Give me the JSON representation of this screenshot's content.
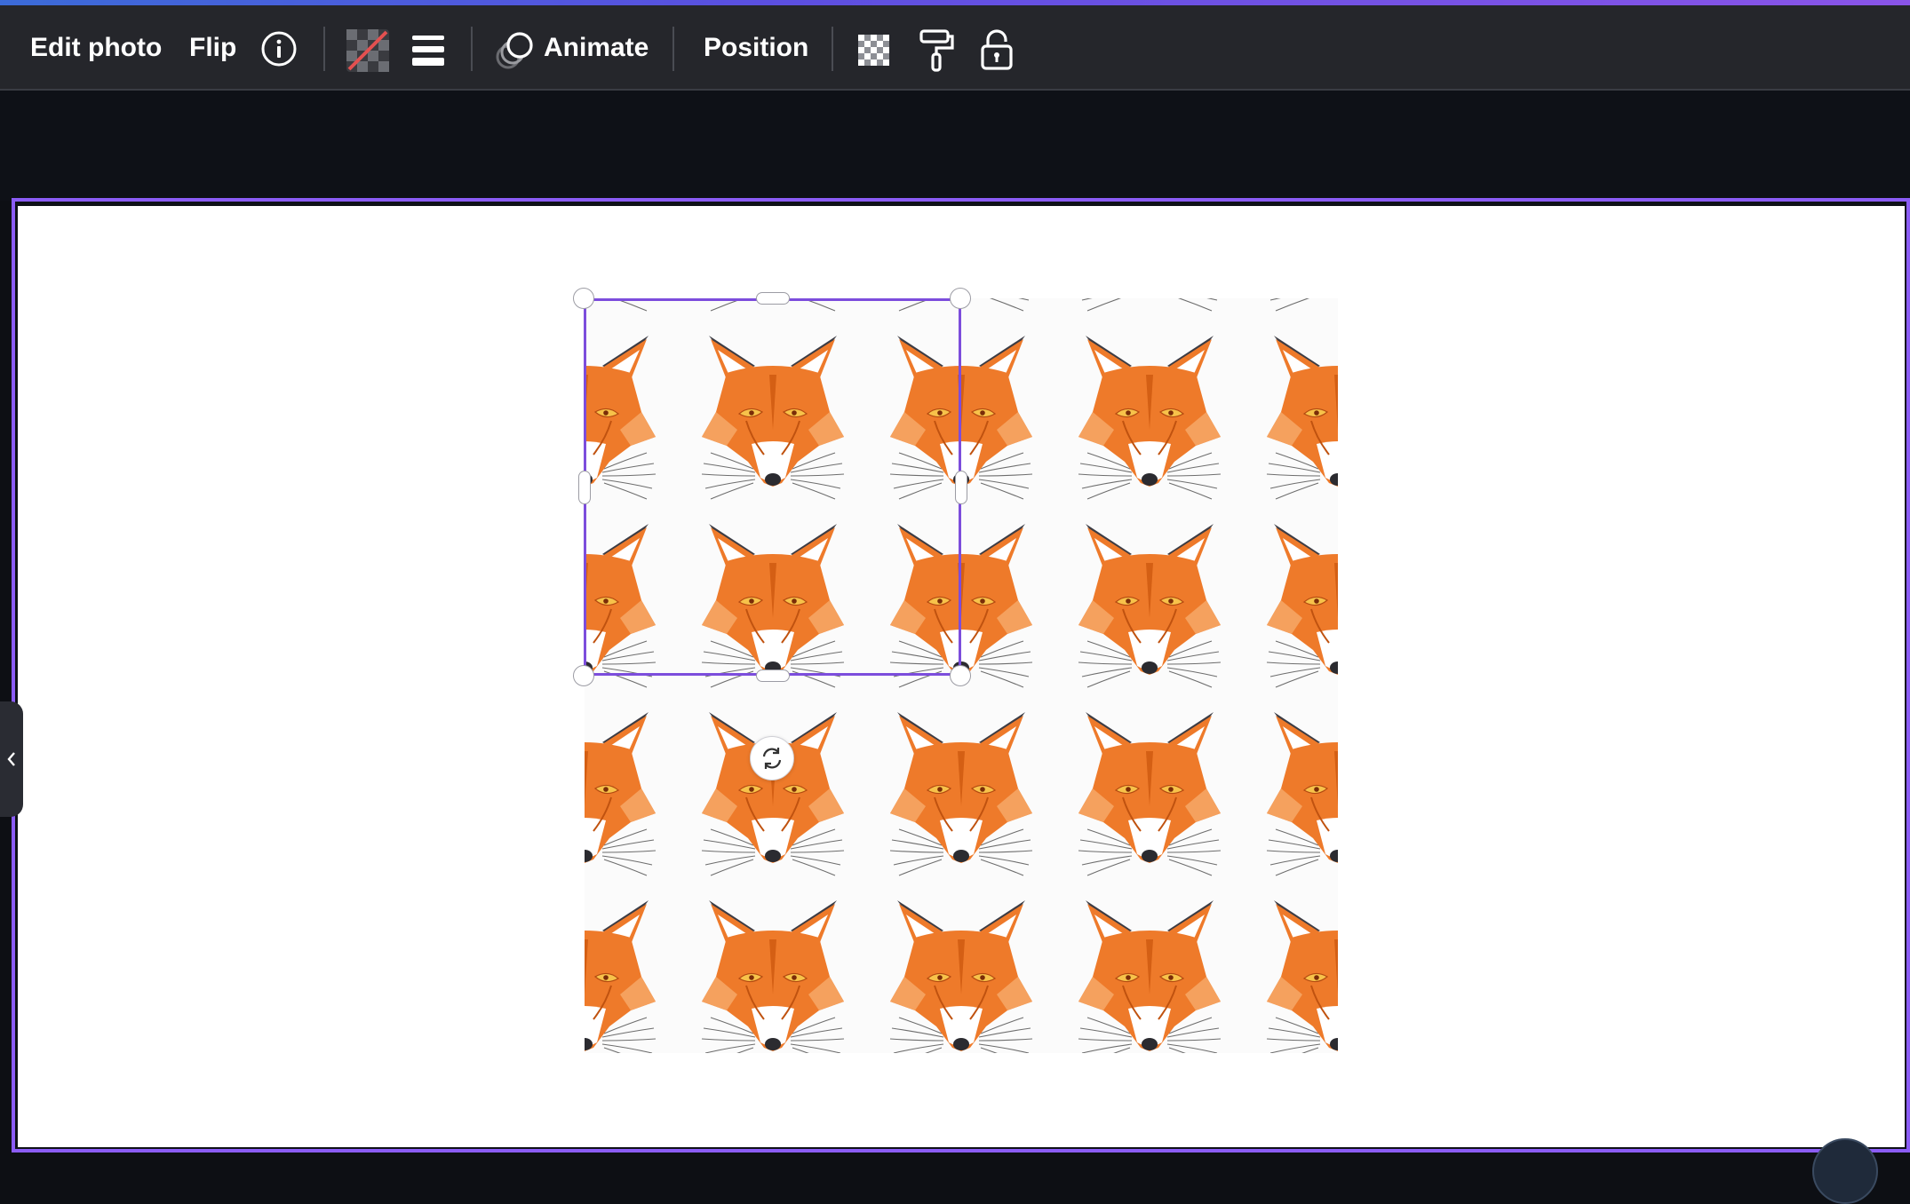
{
  "toolbar": {
    "edit_photo_label": "Edit photo",
    "flip_label": "Flip",
    "info_icon": "info-icon",
    "transparency_icon": "transparency-icon",
    "spacing_icon": "line-spacing-icon",
    "animate_label": "Animate",
    "animate_icon": "animate-icon",
    "position_label": "Position",
    "checker_icon": "checkerboard-transparency-icon",
    "paint_roller_icon": "paint-roller-icon",
    "lock_icon": "lock-icon"
  },
  "canvas": {
    "pattern_image": "fox-face-pattern",
    "pattern_rows": 5,
    "pattern_cols": 5,
    "selection_handles": [
      "top-left",
      "top-middle",
      "top-right",
      "middle-left",
      "middle-right",
      "bottom-left",
      "bottom-middle",
      "bottom-right"
    ],
    "rotate_icon": "rotate-icon"
  },
  "sidebar": {
    "collapse_icon": "chevron-left-icon"
  },
  "colors": {
    "accent": "#8b5cf6",
    "selection": "#7c4ddc",
    "fox_orange": "#ee7a2a",
    "toolbar_bg": "#25262b"
  }
}
